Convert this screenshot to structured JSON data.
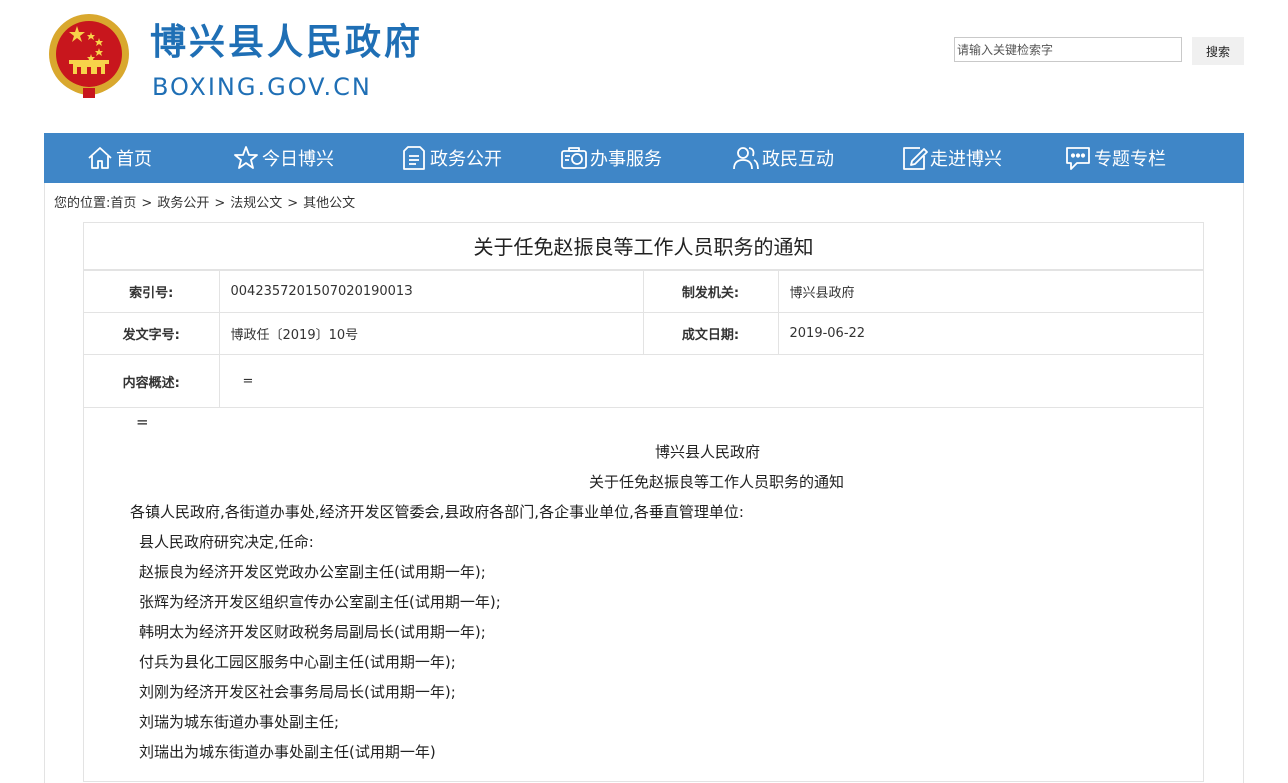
{
  "header": {
    "site_title": "博兴县人民政府",
    "site_domain": "BOXING.GOV.CN",
    "emblem_icon": "national-emblem-icon"
  },
  "search": {
    "placeholder": "请输入关键检索字",
    "button_label": "搜索"
  },
  "nav": {
    "items": [
      {
        "label": "首页",
        "icon": "home-icon"
      },
      {
        "label": "今日博兴",
        "icon": "star-icon"
      },
      {
        "label": "政务公开",
        "icon": "document-icon"
      },
      {
        "label": "办事服务",
        "icon": "service-icon"
      },
      {
        "label": "政民互动",
        "icon": "people-icon"
      },
      {
        "label": "走进博兴",
        "icon": "edit-icon"
      },
      {
        "label": "专题专栏",
        "icon": "chat-icon"
      }
    ]
  },
  "breadcrumb": {
    "prefix": "您的位置:",
    "items": [
      "首页",
      "政务公开",
      "法规公文",
      "其他公文"
    ],
    "separator": ">"
  },
  "article": {
    "title": "关于任免赵振良等工作人员职务的通知",
    "meta": {
      "index_label": "索引号:",
      "index_value": "004235720150702019001З",
      "issuer_label": "制发机关:",
      "issuer_value": "博兴县政府",
      "docno_label": "发文字号:",
      "docno_value": "博政任〔2019〕10号",
      "date_label": "成文日期:",
      "date_value": "2019-06-22",
      "summary_label": "内容概述:",
      "summary_value": "="
    },
    "body": {
      "eq": "=",
      "org": "博兴县人民政府",
      "doc_title": "关于任免赵振良等工作人员职务的通知",
      "recipients": "各镇人民政府,各街道办事处,经济开发区管委会,县政府各部门,各企事业单位,各垂直管理单位:",
      "intro": "县人民政府研究决定,任命:",
      "items": [
        "赵振良为经济开发区党政办公室副主任(试用期一年);",
        "张辉为经济开发区组织宣传办公室副主任(试用期一年);",
        "韩明太为经济开发区财政税务局副局长(试用期一年);",
        "付兵为县化工园区服务中心副主任(试用期一年);",
        "刘刚为经济开发区社会事务局局长(试用期一年);",
        "刘瑞为城东街道办事处副主任;",
        "刘瑞出为城东街道办事处副主任(试用期一年)"
      ]
    }
  },
  "colors": {
    "brand_blue": "#1f6fb5",
    "nav_bg": "#3f86c7",
    "border": "#e3e3e3"
  }
}
